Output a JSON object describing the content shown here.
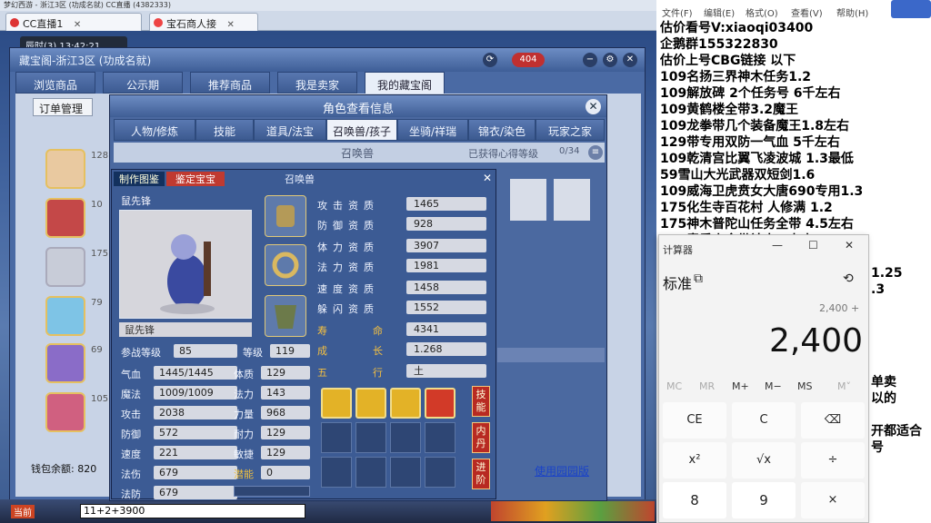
{
  "browser": {
    "topbar_text": "梦幻西游 - 浙江3区 (功成名就)    CC直播 (4382333)",
    "tabs": [
      {
        "label": "CC直播1"
      },
      {
        "label": "宝石商人接"
      }
    ]
  },
  "game": {
    "clock": "辰时(3)  13:42:21",
    "bazaar_title": "藏宝阁-浙江3区 (功成名就)",
    "mail_count": "404",
    "bazaar_tabs": [
      "浏览商品",
      "公示期",
      "推荐商品",
      "我是卖家",
      "我的藏宝阁"
    ],
    "bazaar_active_tab": "我的藏宝阁",
    "order_button": "订单管理",
    "list_rows": [
      {
        "lvl": "128"
      },
      {
        "lvl": "10"
      },
      {
        "lvl": "175"
      },
      {
        "lvl": "79"
      },
      {
        "lvl": "69"
      },
      {
        "lvl": "105"
      }
    ],
    "wallet": "钱包余额: 820",
    "chat_label": "当前",
    "chat_input": "11+2+3900",
    "use_link": "使用园园版"
  },
  "pet_window": {
    "title": "角色查看信息",
    "tabs": [
      "人物/修炼",
      "技能",
      "道具/法宝",
      "召唤兽/孩子",
      "坐骑/祥瑞",
      "锦衣/染色",
      "玩家之家"
    ],
    "active_tab": "召唤兽/孩子",
    "sub_title": "召唤兽",
    "sub_right": "已获得心得等级",
    "sub_page": "0/34"
  },
  "summon": {
    "tab_handbook": "制作图鉴",
    "tab_appraise": "鉴定宝宝",
    "title": "召唤兽",
    "name": "鼠先锋",
    "name_field": "鼠先锋",
    "attrs_left": [
      {
        "label": "参战等级",
        "value": "85"
      },
      {
        "label": "气血",
        "value": "1445/1445"
      },
      {
        "label": "魔法",
        "value": "1009/1009"
      },
      {
        "label": "攻击",
        "value": "2038"
      },
      {
        "label": "防御",
        "value": "572"
      },
      {
        "label": "速度",
        "value": "221"
      },
      {
        "label": "法伤",
        "value": "679"
      },
      {
        "label": "法防",
        "value": "679"
      }
    ],
    "attrs_right": [
      {
        "label": "等级",
        "value": "119"
      },
      {
        "label": "体质",
        "value": "129"
      },
      {
        "label": "法力",
        "value": "143"
      },
      {
        "label": "力量",
        "value": "968"
      },
      {
        "label": "耐力",
        "value": "129"
      },
      {
        "label": "敏捷",
        "value": "129"
      },
      {
        "label": "潜能",
        "value": "0"
      }
    ],
    "qualities": [
      {
        "label": "攻击资质",
        "value": "1465"
      },
      {
        "label": "防御资质",
        "value": "928"
      },
      {
        "label": "体力资质",
        "value": "3907"
      },
      {
        "label": "法力资质",
        "value": "1981"
      },
      {
        "label": "速度资质",
        "value": "1458"
      },
      {
        "label": "躲闪资质",
        "value": "1552"
      },
      {
        "label": "寿命",
        "value": "4341"
      },
      {
        "label": "成长",
        "value": "1.268"
      },
      {
        "label": "五行",
        "value": "土"
      }
    ],
    "side_buttons": [
      "技能",
      "内丹",
      "进阶"
    ]
  },
  "notepad": {
    "menu": [
      "文件(F)",
      "编辑(E)",
      "格式(O)",
      "查看(V)",
      "帮助(H)"
    ],
    "lines": [
      "估价看号V:xiaoqi03400",
      "企鹅群155322830",
      "估价上号CBG链接     以下",
      "109名扬三界神木任务1.2",
      "109解放碑 2个任务号 6千左右",
      "109黄鹤楼全带3.2魔王",
      "109龙拳带几个装备魔王1.8左右",
      "129带专用双防一气血 5千左右",
      "109乾清宫比翼飞凌波城 1.3最低",
      "59雪山大光武器双短剑1.6",
      "109威海卫虎贲女大唐690专用1.3",
      "175化生寺百花村 人修满 1.2",
      "175神木普陀山任务全带 4.5左右",
      "175青黍山全带神木 7左右"
    ],
    "fragments": [
      "1.25",
      ".3",
      "",
      "",
      "单卖",
      "以的",
      "",
      "开都适合",
      "号"
    ]
  },
  "calculator": {
    "title": "计算器",
    "mode": "标准",
    "expression": "2,400 +",
    "display": "2,400",
    "memory": [
      "MC",
      "MR",
      "M+",
      "M−",
      "MS",
      "M˅"
    ],
    "keys": [
      "CE",
      "C",
      "⌫",
      "x²",
      "√x",
      "÷",
      "8",
      "9",
      "×"
    ]
  }
}
